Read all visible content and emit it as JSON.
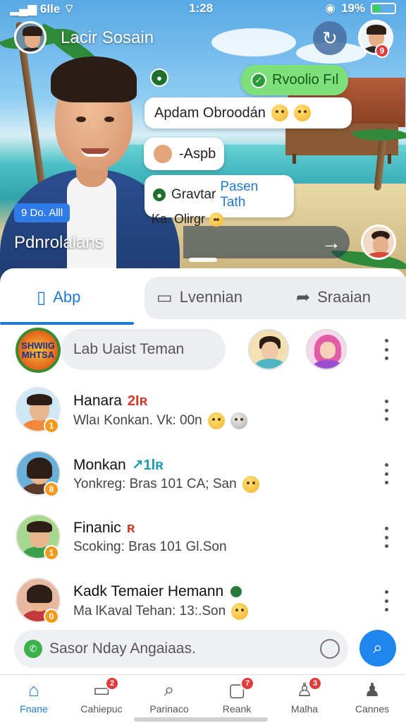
{
  "status_bar": {
    "signal": "6lle",
    "time": "1:28",
    "battery": "19%"
  },
  "header": {
    "username": "Lacir Sosain",
    "profile_badge": "9"
  },
  "hero": {
    "green_chip": "Rvoolio Fıl",
    "bubble_1": "Apdam Obroodán",
    "bubble_2": "-Aspb",
    "bubble_3_title": "Gravtar",
    "bubble_3_highlight": "Pasen Tath",
    "bubble_3_sub": "Ka. Olirgr",
    "blue_chip": "9 Do. Alll",
    "label": "Pdnrolalans"
  },
  "tabs": [
    {
      "label": "Abp"
    },
    {
      "label": "Lvennian"
    },
    {
      "label": "Sraaian"
    }
  ],
  "pill": {
    "logo_text": "SHWIIG MHTSA",
    "label": "Lab Uaist Teman"
  },
  "contacts": [
    {
      "name": "Hanara",
      "tag": "2Iʀ",
      "tag_color": "#d33a2c",
      "sub": "Wlaı Konkan. Vk: 00n",
      "badge": "1"
    },
    {
      "name": "Monkan",
      "tag": "↗1lʀ",
      "tag_color": "#1a9ab0",
      "sub": "Yonkreg: Bras 101 CA; San",
      "badge": "8"
    },
    {
      "name": "Finanic",
      "tag": "ʀ",
      "tag_color": "#d33a2c",
      "sub": "Scoking: Bras 101 Gl.Son",
      "badge": "1"
    },
    {
      "name": "Kadk Temaier Hemann",
      "tag": "",
      "tag_color": "#2a7a3a",
      "sub": "Ma lKaval Tehan: 13:.Son",
      "badge": "0"
    }
  ],
  "search": {
    "placeholder": "Sasor Nday Angaiaas."
  },
  "nav": [
    {
      "label": "Fnane",
      "badge": ""
    },
    {
      "label": "Cahiepuc",
      "badge": "2"
    },
    {
      "label": "Parinaco",
      "badge": ""
    },
    {
      "label": "Reank",
      "badge": "7"
    },
    {
      "label": "Malha",
      "badge": "3"
    },
    {
      "label": "Cannes",
      "badge": ""
    }
  ],
  "colors": {
    "accent": "#1f7ad1",
    "badge_red": "#e23b3b",
    "badge_orange": "#f29a1a",
    "green_chip": "#7ee07a"
  }
}
